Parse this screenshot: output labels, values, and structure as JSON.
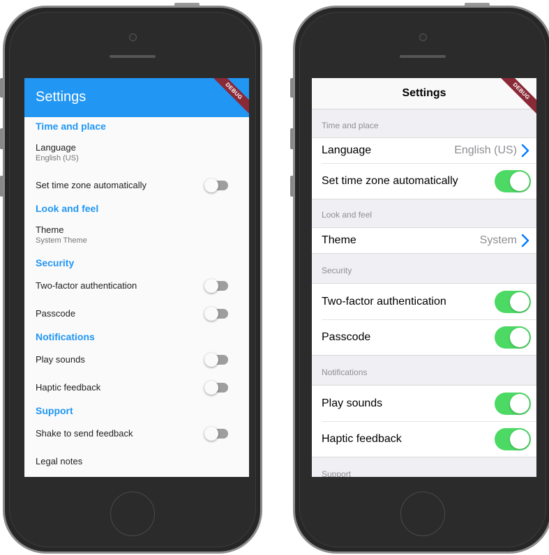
{
  "material": {
    "app_bar_title": "Settings",
    "debug_label": "DEBUG",
    "sections": [
      {
        "header": "Time and place",
        "tiles": [
          {
            "title": "Language",
            "subtitle": "English (US)"
          },
          {
            "title": "Set time zone automatically",
            "switch_on": false
          }
        ]
      },
      {
        "header": "Look and feel",
        "tiles": [
          {
            "title": "Theme",
            "subtitle": "System Theme"
          }
        ]
      },
      {
        "header": "Security",
        "tiles": [
          {
            "title": "Two-factor authentication",
            "switch_on": false
          },
          {
            "title": "Passcode",
            "switch_on": false
          }
        ]
      },
      {
        "header": "Notifications",
        "tiles": [
          {
            "title": "Play sounds",
            "switch_on": false
          },
          {
            "title": "Haptic feedback",
            "switch_on": false
          }
        ]
      },
      {
        "header": "Support",
        "tiles": [
          {
            "title": "Shake to send feedback",
            "switch_on": false
          },
          {
            "title": "Legal notes"
          }
        ]
      }
    ],
    "colors": {
      "app_bar": "#2196f3",
      "section_header": "#2196f3"
    }
  },
  "cupertino": {
    "nav_title": "Settings",
    "debug_label": "DEBUG",
    "sections": [
      {
        "header": "Time and place",
        "rows": [
          {
            "title": "Language",
            "value": "English (US)",
            "icon": "chevron-right-icon"
          },
          {
            "title": "Set time zone automatically",
            "switch_on": true
          }
        ]
      },
      {
        "header": "Look and feel",
        "rows": [
          {
            "title": "Theme",
            "value": "System",
            "icon": "chevron-right-icon"
          }
        ]
      },
      {
        "header": "Security",
        "rows": [
          {
            "title": "Two-factor authentication",
            "switch_on": true
          },
          {
            "title": "Passcode",
            "switch_on": true
          }
        ]
      },
      {
        "header": "Notifications",
        "rows": [
          {
            "title": "Play sounds",
            "switch_on": true
          },
          {
            "title": "Haptic feedback",
            "switch_on": true
          }
        ]
      },
      {
        "header": "Support"
      }
    ],
    "colors": {
      "switch_on": "#4cd964",
      "chevron": "#007aff",
      "background": "#efeff4"
    }
  }
}
